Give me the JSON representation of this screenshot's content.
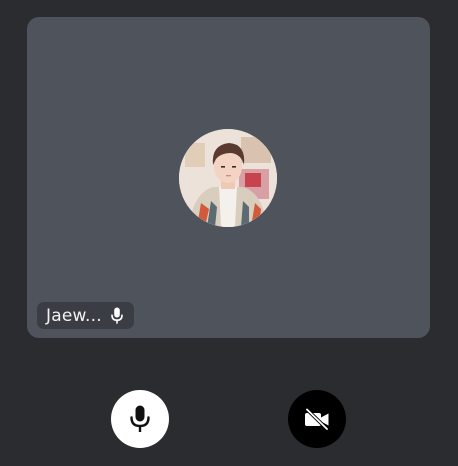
{
  "participant": {
    "name": "Jaew...",
    "avatar_icon": "profile-photo",
    "mic_status_icon": "microphone-icon"
  },
  "controls": {
    "mic_icon": "microphone-icon",
    "mic_state": "on",
    "camera_icon": "video-off-icon",
    "camera_state": "off"
  },
  "colors": {
    "background": "#2b2c30",
    "tile": "#4f535c",
    "name_tag": "#3a3d44",
    "mic_button": "#ffffff",
    "camera_button": "#000000"
  }
}
